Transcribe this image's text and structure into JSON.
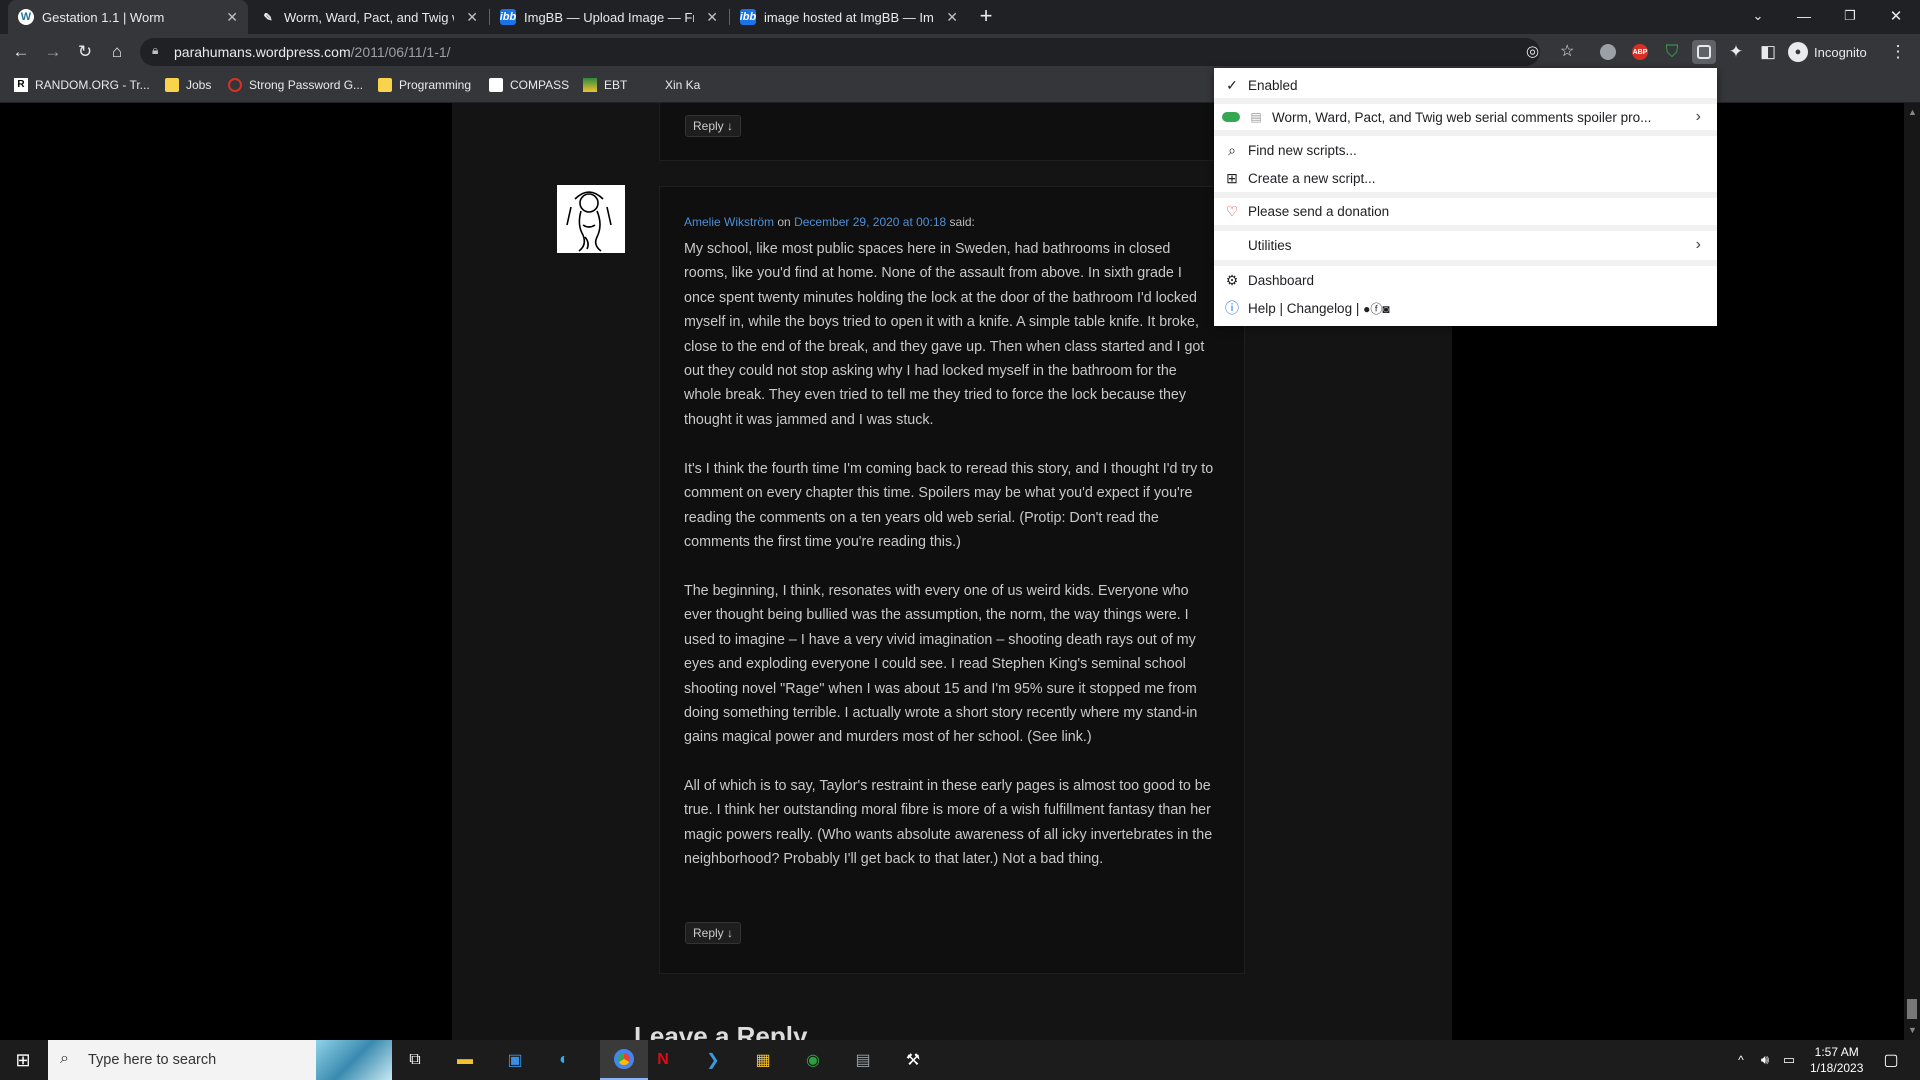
{
  "tabs": [
    {
      "title": "Gestation 1.1 | Worm",
      "icon": "wordpress-icon"
    },
    {
      "title": "Worm, Ward, Pact, and Twig web",
      "icon": "pen-icon"
    },
    {
      "title": "ImgBB — Upload Image — Free I",
      "icon": "imgbb-icon"
    },
    {
      "title": "image hosted at ImgBB — ImgBB",
      "icon": "imgbb-icon"
    }
  ],
  "address": {
    "domain": "parahumans.wordpress.com",
    "path": "/2011/06/11/1-1/"
  },
  "profile": {
    "label": "Incognito"
  },
  "bookmarks": [
    {
      "label": "RANDOM.ORG - Tr..."
    },
    {
      "label": "Jobs"
    },
    {
      "label": "Strong Password G..."
    },
    {
      "label": "Programming"
    },
    {
      "label": "COMPASS"
    },
    {
      "label": "EBT"
    },
    {
      "label": "Xin Ka"
    }
  ],
  "comment": {
    "reply_label": "Reply ↓",
    "author": "Amelie Wikström",
    "on": "on",
    "date": "December 29, 2020 at 00:18",
    "said": "said:",
    "paragraphs": [
      "My school, like most public spaces here in Sweden, had bathrooms in closed rooms, like you'd find at home. None of the assault from above. In sixth grade I once spent twenty minutes holding the lock at the door of the bathroom I'd locked myself in, while the boys tried to open it with a knife. A simple table knife. It broke, close to the end of the break, and they gave up. Then when class started and I got out they could not stop asking why I had locked myself in the bathroom for the whole break. They even tried to tell me they tried to force the lock because they thought it was jammed and I was stuck.",
      "It's I think the fourth time I'm coming back to reread this story, and I thought I'd try to comment on every chapter this time. Spoilers may be what you'd expect if you're reading the comments on a ten years old web serial. (Protip: Don't read the comments the first time you're reading this.)",
      "The beginning, I think, resonates with every one of us weird kids. Everyone who ever thought being bullied was the assumption, the norm, the way things were. I used to imagine – I have a very vivid imagination – shooting death rays out of my eyes and exploding everyone I could see. I read Stephen King's seminal school shooting novel \"Rage\" when I was about 15 and I'm 95% sure it stopped me from doing something terrible. I actually wrote a short story recently where my stand-in gains magical power and murders most of her school. (See link.)",
      "All of which is to say, Taylor's restraint in these early pages is almost too good to be true. I think her outstanding moral fibre is more of a wish fulfillment fantasy than her magic powers really. (Who wants absolute awareness of all icky invertebrates in the neighborhood? Probably I'll get back to that later.) Not a bad thing."
    ]
  },
  "leave_reply": "Leave a Reply",
  "menu": {
    "enabled": "Enabled",
    "script_name": "Worm, Ward, Pact, and Twig web serial comments spoiler pro...",
    "find": "Find new scripts...",
    "create": "Create a new script...",
    "donate": "Please send a donation",
    "utilities": "Utilities",
    "dashboard": "Dashboard",
    "help": "Help | Changelog |"
  },
  "taskbar": {
    "search_placeholder": "Type here to search",
    "time": "1:57 AM",
    "date": "1/18/2023"
  }
}
